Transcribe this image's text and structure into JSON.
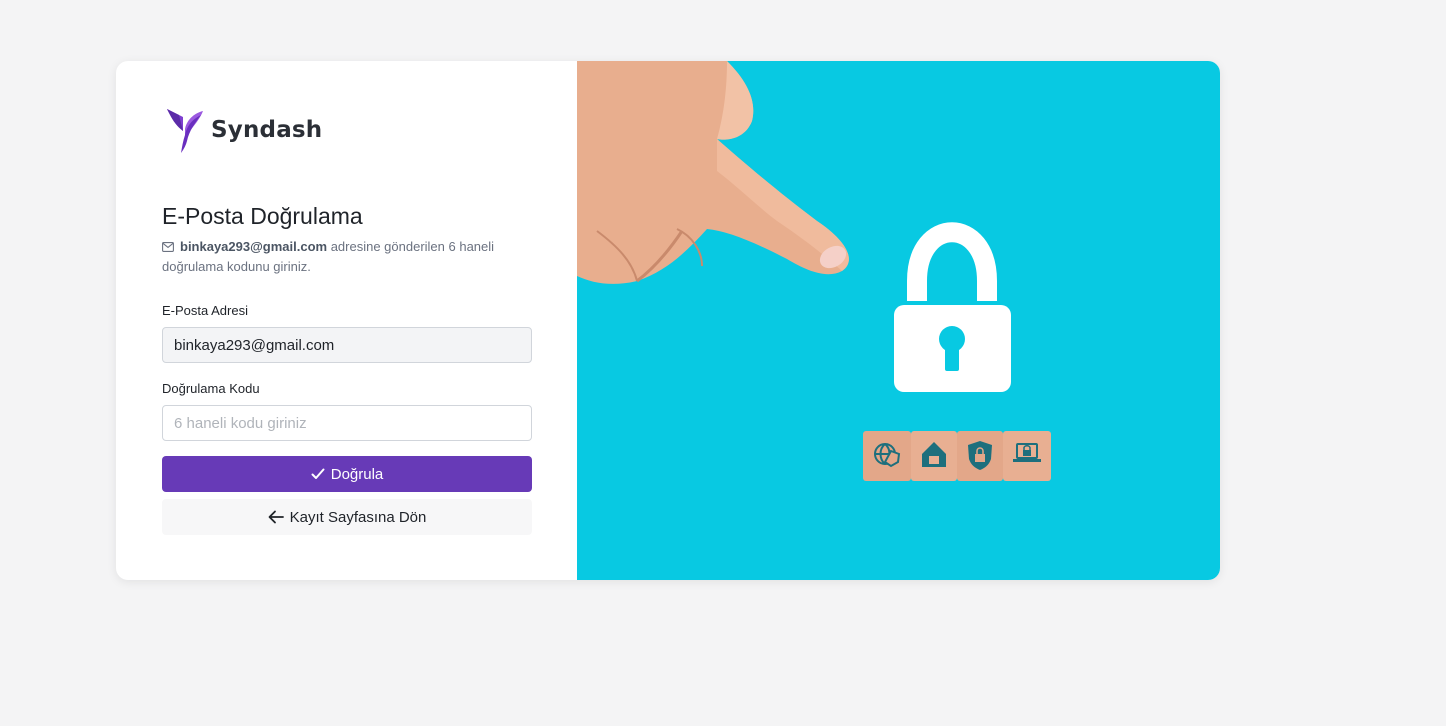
{
  "brand": {
    "name": "Syndash",
    "accent": "#673ab7"
  },
  "page": {
    "title": "E-Posta Doğrulama",
    "email_bold": "binkaya293@gmail.com",
    "desc_rest": " adresine gönderilen 6 haneli doğrulama kodunu giriniz."
  },
  "form": {
    "email_label": "E-Posta Adresi",
    "email_value": "binkaya293@gmail.com",
    "code_label": "Doğrulama Kodu",
    "code_placeholder": "6 haneli kodu giriniz",
    "verify_label": "Doğrula",
    "back_label": "Kayıt Sayfasına Dön"
  },
  "illustration": {
    "background": "#08c9e2",
    "icons": [
      "globe-shield-icon",
      "home-lock-icon",
      "shield-lock-icon",
      "laptop-lock-icon"
    ]
  }
}
